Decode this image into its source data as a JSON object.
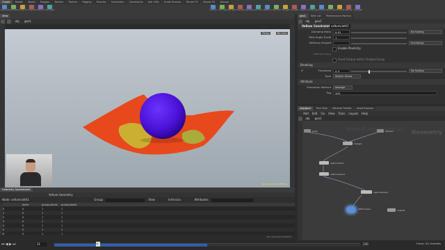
{
  "top_tabs": [
    "Create",
    "Modify",
    "Model",
    "Polygon",
    "Deform",
    "Texture",
    "Rigging",
    "Muscles",
    "Characters",
    "Constraints",
    "Hair Utils",
    "Guide Process",
    "Terrain FX",
    "Simple FX",
    "Volume"
  ],
  "left_tools": [
    "Scene View",
    "Animation Editor",
    "Render View",
    "Composite View",
    "Motion FX View",
    "Geometry Spreadsheet"
  ],
  "right_tools": [
    "Camera",
    "Point Light",
    "Spot Light",
    "Area Light",
    "Geometry Light",
    "Volume Light",
    "Distant Light",
    "Environment Light",
    "Sky Light",
    "GI Light",
    "Caustic Light",
    "Portal Light",
    "Ambient Light",
    "Stereo Camera",
    "VR Camera",
    "Switcher",
    "Gamepad Camera"
  ],
  "viewport": {
    "tab_label": "View",
    "path": "obj",
    "node": "geo1",
    "persp": "Persp",
    "cam": "No cam",
    "status_text": "Non-Commercial Edition"
  },
  "params": {
    "tabs": [
      "geo1",
      "Take List",
      "Performance Monitor"
    ],
    "path": "obj",
    "node": "geo1",
    "header_type": "Vellum Constraints",
    "header_name": "vellumcloth1",
    "rows": [
      {
        "label": "Damping Ratio",
        "value": "0.01",
        "unit": "No Scaling"
      },
      {
        "label": "Rest Angle Scale",
        "value": "1"
      },
      {
        "label": "Stiffness Dropoff",
        "value": "",
        "unit": "Increasing"
      }
    ],
    "enable_plasticity": "Enable Plasticity",
    "define_group": "Define Group",
    "fixed_output": "Fixed Output within Output Group",
    "breaking_section": "Breaking",
    "threshold_label": "Threshold",
    "threshold_value": "0.3",
    "threshold_unit": "No Scaling",
    "type_label": "Type",
    "type_value": "Stretch Stress",
    "attribute_section": "Attribute",
    "promotion_label": "Promotion Method",
    "promotion_value": "Average",
    "tag_label": "Tag",
    "tag_value": "505"
  },
  "network": {
    "tabs": [
      "/obj/geo1",
      "Tree View",
      "Material Palette",
      "Asset Browser"
    ],
    "menu": [
      "Add",
      "Edit",
      "Go",
      "View",
      "Tools",
      "Layout",
      "Help"
    ],
    "path": "obj",
    "node": "geo1",
    "watermark": "Non-Commercial",
    "geo_label": "Geometry",
    "nodes": [
      {
        "name": "grid1",
        "color": "#888888"
      },
      {
        "name": "sphere1",
        "color": "#888888"
      },
      {
        "name": "merge1",
        "color": "#aaaaaa"
      },
      {
        "name": "vellumcloth1",
        "color": "#bbbbbb"
      },
      {
        "name": "vellumsolver1",
        "color": "#bbbbbb"
      },
      {
        "name": "vellumsolver2",
        "color": "#bbbbbb"
      },
      {
        "name": "attribnoise1",
        "color": "#5b8fd6"
      },
      {
        "name": "output1",
        "color": "#9a9a9a"
      }
    ]
  },
  "spreadsheet": {
    "tab_label": "Geometry Spreadsheet",
    "tab2": "Vellum Geometry",
    "node": "Node: vellumcloth1",
    "group": "Group:",
    "view": "View",
    "intrinsics": "Intrinsics",
    "attributes": "Attributes:",
    "columns": [
      "",
      "piece",
      "group:pieces",
      "group:plastic"
    ],
    "rows": [
      [
        "0",
        "0",
        "1",
        "1"
      ],
      [
        "1",
        "0",
        "1",
        "1"
      ],
      [
        "2",
        "0",
        "1",
        "1"
      ],
      [
        "3",
        "0",
        "1",
        "1"
      ],
      [
        "4",
        "0",
        "1",
        "1"
      ],
      [
        "5",
        "0",
        "1",
        "1"
      ],
      [
        "6",
        "0",
        "1",
        "1"
      ],
      [
        "7",
        "0",
        "1",
        "1"
      ]
    ],
    "footer": "Non-Commercial Edition"
  },
  "timeline": {
    "frame": "11",
    "marker": "11",
    "end": "240",
    "right_text": "1 keys, 0/1 channels"
  }
}
